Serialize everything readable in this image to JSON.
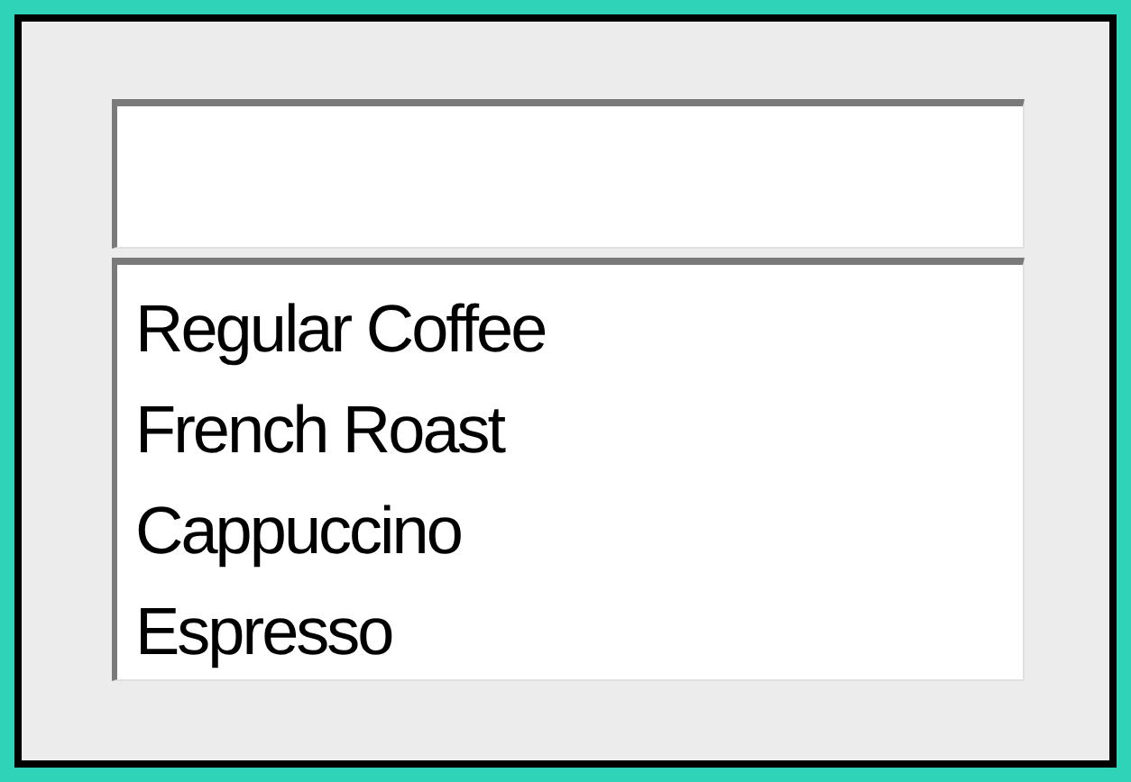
{
  "combo_box": {
    "items": [
      {
        "label": "Regular Coffee"
      },
      {
        "label": "French Roast"
      },
      {
        "label": "Cappuccino"
      },
      {
        "label": "Espresso"
      }
    ]
  }
}
